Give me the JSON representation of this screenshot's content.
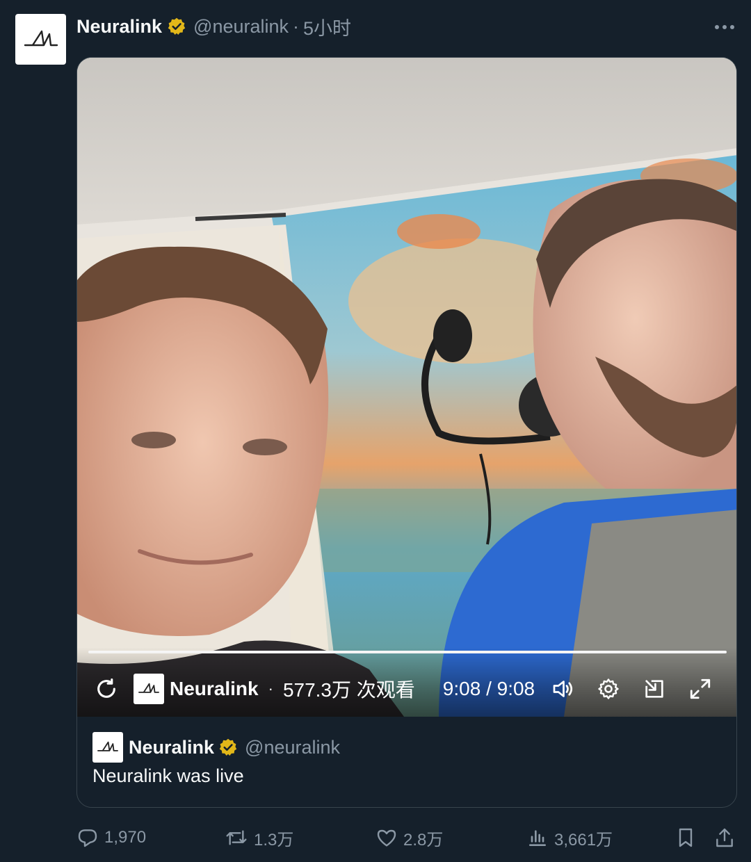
{
  "post": {
    "author_name": "Neuralink",
    "handle": "@neuralink",
    "separator": "·",
    "time": "5小时",
    "more_icon": "more-horizontal-icon",
    "verified_color": "#e2b719"
  },
  "video": {
    "channel_name": "Neuralink",
    "separator": "·",
    "views": "577.3万 次观看",
    "timestamp": "9:08 / 9:08",
    "progress": 1.0,
    "icons": [
      "replay-icon",
      "volume-icon",
      "settings-icon",
      "dock-icon",
      "fullscreen-icon"
    ]
  },
  "quote": {
    "author_name": "Neuralink",
    "handle": "@neuralink",
    "text": "Neuralink was live"
  },
  "actions": {
    "replies": "1,970",
    "reposts": "1.3万",
    "likes": "2.8万",
    "views": "3,661万"
  },
  "colors": {
    "background": "#15202b",
    "secondary_text": "#8b98a5",
    "border": "#38444d"
  }
}
